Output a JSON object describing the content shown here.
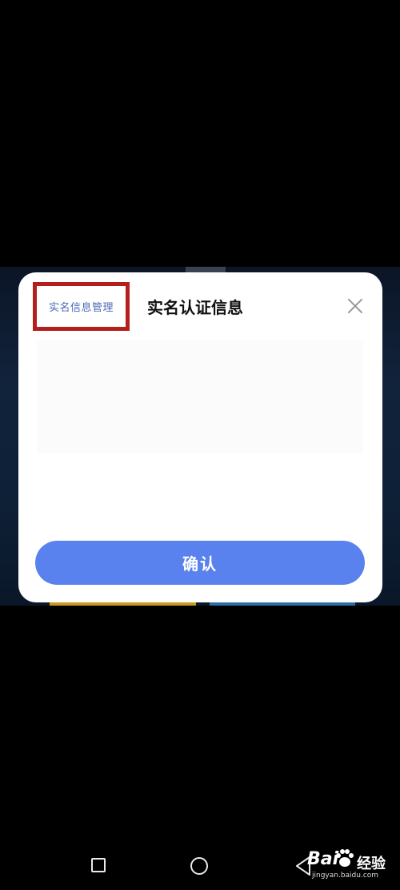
{
  "dialog": {
    "manage_link": "实名信息管理",
    "title": "实名认证信息",
    "confirm_label": "确认",
    "close_icon": "close-icon"
  },
  "navbar": {
    "recent_icon": "square-icon",
    "home_icon": "circle-icon",
    "back_icon": "triangle-back-icon"
  },
  "watermark": {
    "text": "Bai",
    "cn": "经验",
    "url": "jingyan.baidu.com"
  },
  "colors": {
    "accent": "#5a82ef",
    "highlight_border": "#b51f1b",
    "link": "#4a69b7"
  }
}
